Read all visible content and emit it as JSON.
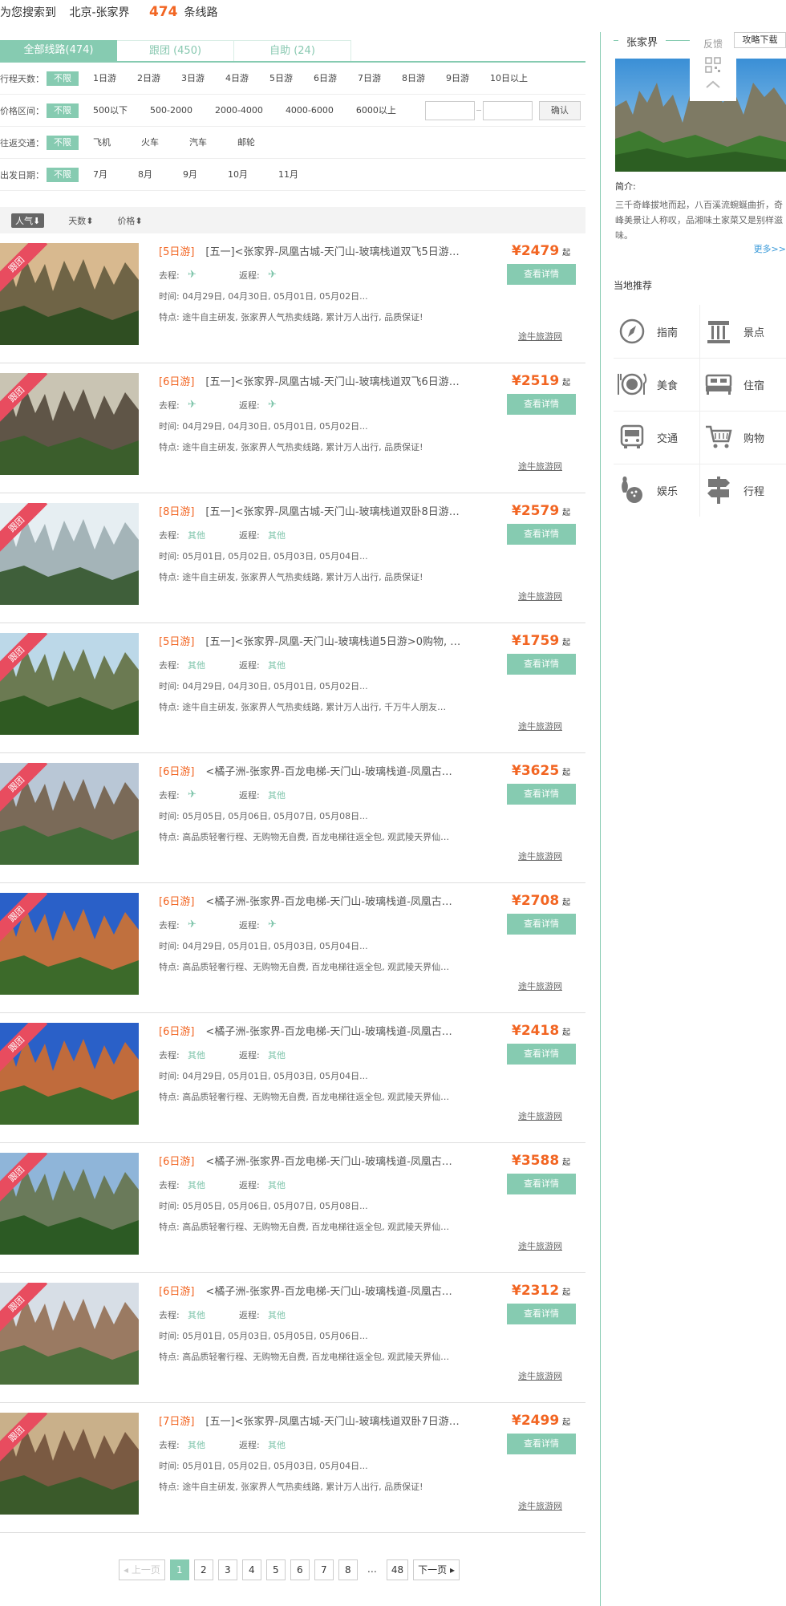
{
  "search": {
    "prefix": "为您搜索到",
    "city": "北京-张家界",
    "count": "474",
    "suffix": "条线路"
  },
  "tabs": [
    {
      "label": "全部线路(474)"
    },
    {
      "label": "跟团 (450)"
    },
    {
      "label": "自助 (24)"
    }
  ],
  "filters": {
    "days": {
      "label": "行程天数：",
      "options": [
        "不限",
        "1日游",
        "2日游",
        "3日游",
        "4日游",
        "5日游",
        "6日游",
        "7日游",
        "8日游",
        "9日游",
        "10日以上"
      ]
    },
    "price": {
      "label": "价格区间：",
      "options": [
        "不限",
        "500以下",
        "500-2000",
        "2000-4000",
        "4000-6000",
        "6000以上"
      ],
      "confirm": "确认"
    },
    "transport": {
      "label": "往返交通：",
      "options": [
        "不限",
        "飞机",
        "火车",
        "汽车",
        "邮轮"
      ]
    },
    "date": {
      "label": "出发日期：",
      "options": [
        "不限",
        "7月",
        "8月",
        "9月",
        "10月",
        "11月"
      ]
    }
  },
  "sort": [
    {
      "label": "人气⬇"
    },
    {
      "label": "天数⬍"
    },
    {
      "label": "价格⬍"
    }
  ],
  "routes": [
    {
      "days": "[5日游]",
      "title": "[五一]<张家界-凤凰古城-天门山-玻璃栈道双飞5日游…",
      "go_label": "去程:",
      "go": "✈",
      "back_label": "返程:",
      "back": "✈",
      "time": "时间:  04月29日, 04月30日, 05月01日, 05月02日...",
      "feature": "特点: 途牛自主研发, 张家界人气热卖线路, 累计万人出行, 品质保证!",
      "price": "¥2479",
      "qi": "起",
      "btn": "查看详情",
      "source": "途牛旅游网",
      "tag": "跟团"
    },
    {
      "days": "[6日游]",
      "title": "[五一]<张家界-凤凰古城-天门山-玻璃栈道双飞6日游…",
      "go_label": "去程:",
      "go": "✈",
      "back_label": "返程:",
      "back": "✈",
      "time": "时间:  04月29日, 04月30日, 05月01日, 05月02日...",
      "feature": "特点: 途牛自主研发, 张家界人气热卖线路, 累计万人出行, 品质保证!",
      "price": "¥2519",
      "qi": "起",
      "btn": "查看详情",
      "source": "途牛旅游网",
      "tag": "跟团"
    },
    {
      "days": "[8日游]",
      "title": "[五一]<张家界-凤凰古城-天门山-玻璃栈道双卧8日游…",
      "go_label": "去程:",
      "go": "其他",
      "back_label": "返程:",
      "back": "其他",
      "time": "时间:  05月01日, 05月02日, 05月03日, 05月04日...",
      "feature": "特点: 途牛自主研发, 张家界人气热卖线路, 累计万人出行, 品质保证!",
      "price": "¥2579",
      "qi": "起",
      "btn": "查看详情",
      "source": "途牛旅游网",
      "tag": "跟团"
    },
    {
      "days": "[5日游]",
      "title": "[五一]<张家界-凤凰-天门山-玻璃栈道5日游>0购物, …",
      "go_label": "去程:",
      "go": "其他",
      "back_label": "返程:",
      "back": "其他",
      "time": "时间:  04月29日, 04月30日, 05月01日, 05月02日...",
      "feature": "特点: 途牛自主研发, 张家界人气热卖线路, 累计万人出行, 千万牛人朋友…",
      "price": "¥1759",
      "qi": "起",
      "btn": "查看详情",
      "source": "途牛旅游网",
      "tag": "跟团"
    },
    {
      "days": "[6日游]",
      "title": "<橘子洲-张家界-百龙电梯-天门山-玻璃栈道-凤凰古…",
      "go_label": "去程:",
      "go": "✈",
      "back_label": "返程:",
      "back": "其他",
      "time": "时间:  05月05日, 05月06日, 05月07日, 05月08日...",
      "feature": "特点: 高品质轻奢行程、无购物无自费, 百龙电梯往返全包, 观武陵天界仙…",
      "price": "¥3625",
      "qi": "起",
      "btn": "查看详情",
      "source": "途牛旅游网",
      "tag": "跟团"
    },
    {
      "days": "[6日游]",
      "title": "<橘子洲-张家界-百龙电梯-天门山-玻璃栈道-凤凰古…",
      "go_label": "去程:",
      "go": "✈",
      "back_label": "返程:",
      "back": "✈",
      "time": "时间:  04月29日, 05月01日, 05月03日, 05月04日...",
      "feature": "特点: 高品质轻奢行程、无购物无自费, 百龙电梯往返全包, 观武陵天界仙…",
      "price": "¥2708",
      "qi": "起",
      "btn": "查看详情",
      "source": "途牛旅游网",
      "tag": "跟团"
    },
    {
      "days": "[6日游]",
      "title": "<橘子洲-张家界-百龙电梯-天门山-玻璃栈道-凤凰古…",
      "go_label": "去程:",
      "go": "其他",
      "back_label": "返程:",
      "back": "其他",
      "time": "时间:  04月29日, 05月01日, 05月03日, 05月04日...",
      "feature": "特点: 高品质轻奢行程、无购物无自费, 百龙电梯往返全包, 观武陵天界仙…",
      "price": "¥2418",
      "qi": "起",
      "btn": "查看详情",
      "source": "途牛旅游网",
      "tag": "跟团"
    },
    {
      "days": "[6日游]",
      "title": "<橘子洲-张家界-百龙电梯-天门山-玻璃栈道-凤凰古…",
      "go_label": "去程:",
      "go": "其他",
      "back_label": "返程:",
      "back": "其他",
      "time": "时间:  05月05日, 05月06日, 05月07日, 05月08日...",
      "feature": "特点: 高品质轻奢行程、无购物无自费, 百龙电梯往返全包, 观武陵天界仙…",
      "price": "¥3588",
      "qi": "起",
      "btn": "查看详情",
      "source": "途牛旅游网",
      "tag": "跟团"
    },
    {
      "days": "[6日游]",
      "title": "<橘子洲-张家界-百龙电梯-天门山-玻璃栈道-凤凰古…",
      "go_label": "去程:",
      "go": "其他",
      "back_label": "返程:",
      "back": "其他",
      "time": "时间:  05月01日, 05月03日, 05月05日, 05月06日...",
      "feature": "特点: 高品质轻奢行程、无购物无自费, 百龙电梯往返全包, 观武陵天界仙…",
      "price": "¥2312",
      "qi": "起",
      "btn": "查看详情",
      "source": "途牛旅游网",
      "tag": "跟团"
    },
    {
      "days": "[7日游]",
      "title": "[五一]<张家界-凤凰古城-天门山-玻璃栈道双卧7日游…",
      "go_label": "去程:",
      "go": "其他",
      "back_label": "返程:",
      "back": "其他",
      "time": "时间:  05月01日, 05月02日, 05月03日, 05月04日...",
      "feature": "特点: 途牛自主研发, 张家界人气热卖线路, 累计万人出行, 品质保证!",
      "price": "¥2499",
      "qi": "起",
      "btn": "查看详情",
      "source": "途牛旅游网",
      "tag": "跟团"
    }
  ],
  "pager": {
    "prev": "◂ 上一页",
    "pages": [
      "1",
      "2",
      "3",
      "4",
      "5",
      "6",
      "7",
      "8"
    ],
    "ellipsis": "…",
    "last": "48",
    "next": "下一页 ▸"
  },
  "sidebar": {
    "title": "张家界",
    "feedback": "反馈",
    "guide_download": "攻略下载",
    "intro_label": "简介:",
    "intro": "三千奇峰拔地而起，八百溪流蜿蜒曲折，奇峰美景让人称叹，品湘味土家菜又是别样滋味。",
    "more": "更多>>",
    "rec_title": "当地推荐",
    "rec": [
      {
        "label": "指南",
        "icon": "compass-icon"
      },
      {
        "label": "景点",
        "icon": "column-icon"
      },
      {
        "label": "美食",
        "icon": "dining-icon"
      },
      {
        "label": "住宿",
        "icon": "bed-icon"
      },
      {
        "label": "交通",
        "icon": "bus-icon"
      },
      {
        "label": "购物",
        "icon": "cart-icon"
      },
      {
        "label": "娱乐",
        "icon": "bowling-icon"
      },
      {
        "label": "行程",
        "icon": "signpost-icon"
      }
    ],
    "accent": "#86cbb1"
  },
  "colors": {
    "accent": "#86cbb1",
    "price": "#f26522",
    "tag": "#e84c5f"
  }
}
